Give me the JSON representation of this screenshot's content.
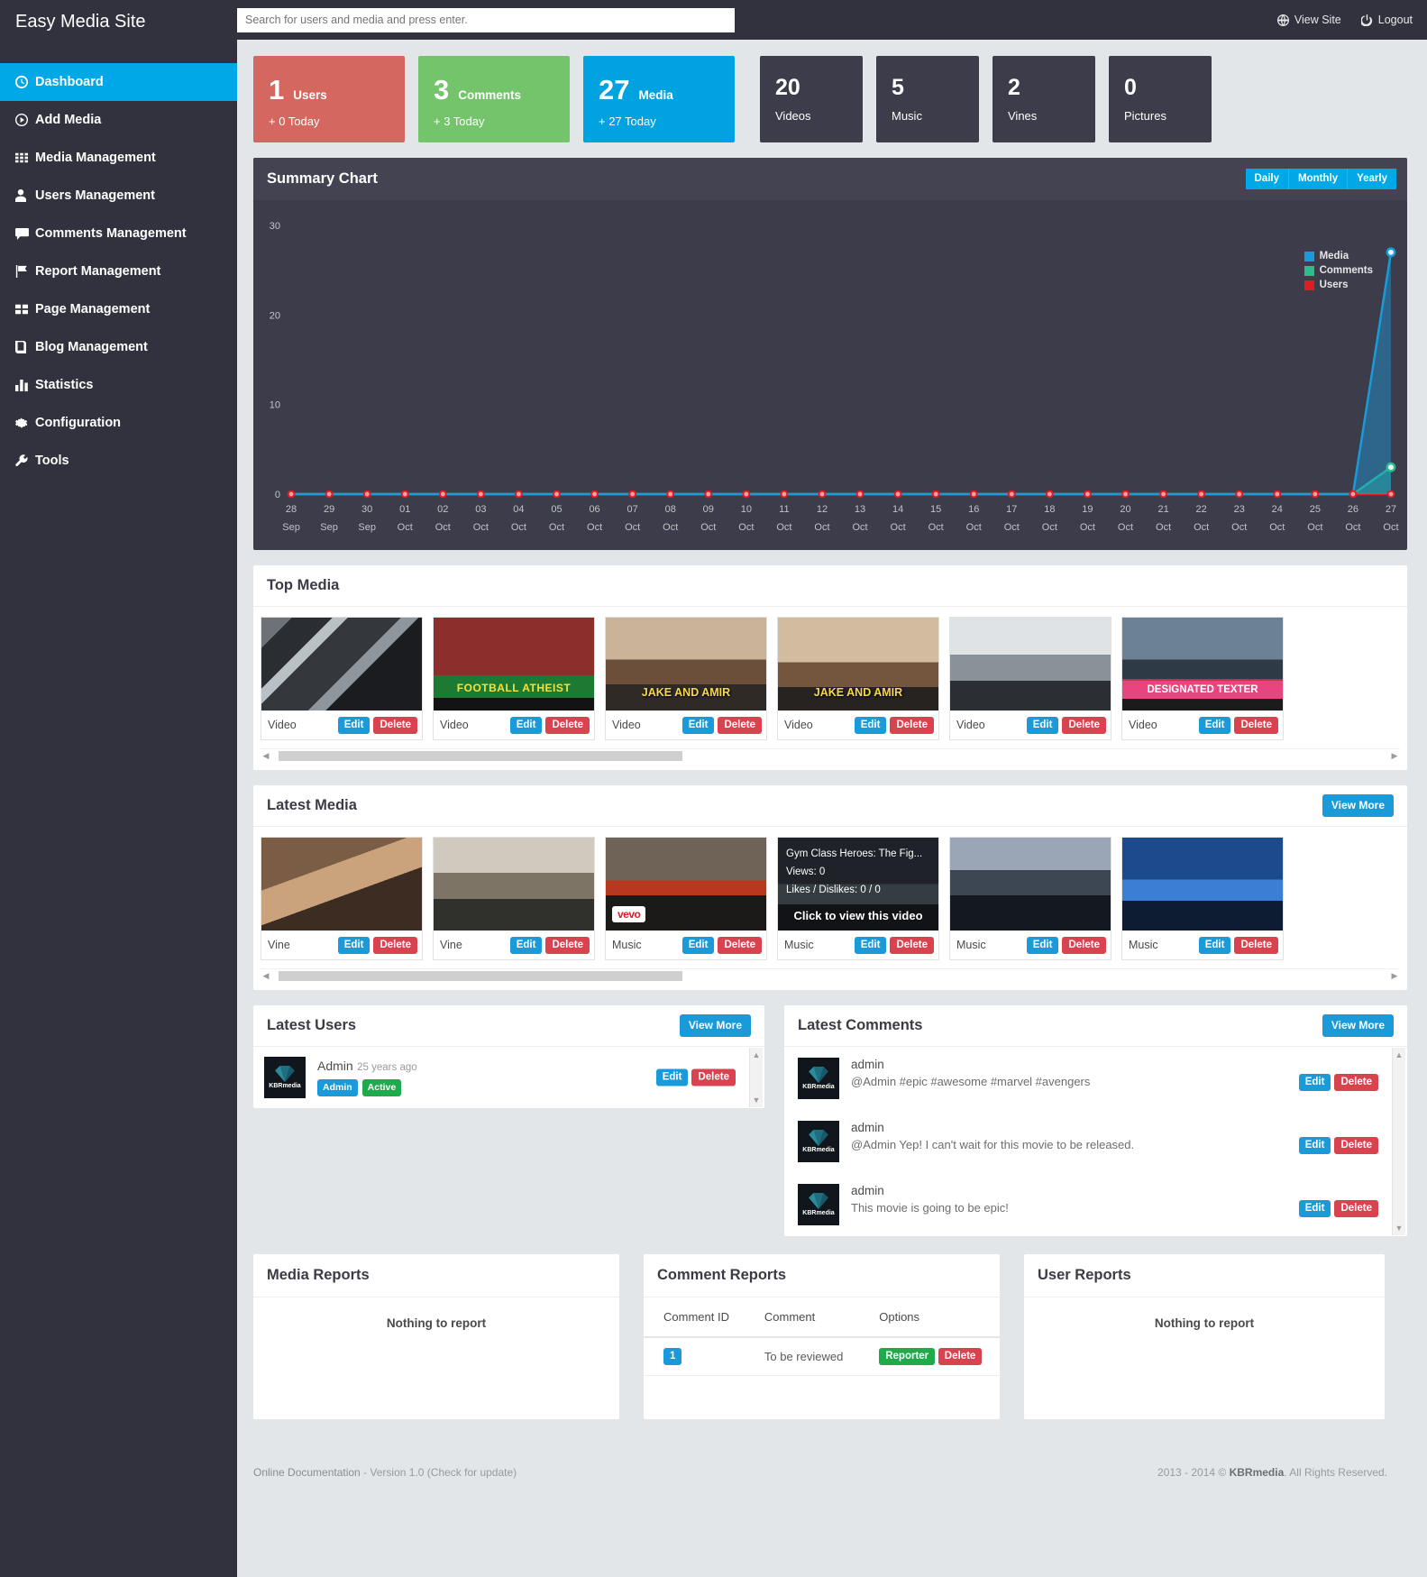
{
  "brand": "Easy Media Site",
  "search": {
    "placeholder": "Search for users and media and press enter."
  },
  "topbar": {
    "view_site": "View Site",
    "logout": "Logout"
  },
  "sidebar": {
    "items": [
      {
        "label": "Dashboard",
        "icon": "dashboard-icon",
        "active": true
      },
      {
        "label": "Add Media",
        "icon": "add-media-icon",
        "active": false
      },
      {
        "label": "Media Management",
        "icon": "grid-icon",
        "active": false
      },
      {
        "label": "Users Management",
        "icon": "user-icon",
        "active": false
      },
      {
        "label": "Comments Management",
        "icon": "comment-icon",
        "active": false
      },
      {
        "label": "Report Management",
        "icon": "flag-icon",
        "active": false
      },
      {
        "label": "Page Management",
        "icon": "pages-icon",
        "active": false
      },
      {
        "label": "Blog Management",
        "icon": "book-icon",
        "active": false
      },
      {
        "label": "Statistics",
        "icon": "bar-chart-icon",
        "active": false
      },
      {
        "label": "Configuration",
        "icon": "gear-icon",
        "active": false
      },
      {
        "label": "Tools",
        "icon": "wrench-icon",
        "active": false
      }
    ]
  },
  "stats": {
    "primary": [
      {
        "value": "1",
        "label": "Users",
        "sub": "+ 0 Today",
        "color": "#d4675f"
      },
      {
        "value": "3",
        "label": "Comments",
        "sub": "+ 3 Today",
        "color": "#73c46b"
      },
      {
        "value": "27",
        "label": "Media",
        "sub": "+ 27 Today",
        "color": "#00a3e0"
      }
    ],
    "secondary": [
      {
        "value": "20",
        "label": "Videos"
      },
      {
        "value": "5",
        "label": "Music"
      },
      {
        "value": "2",
        "label": "Vines"
      },
      {
        "value": "0",
        "label": "Pictures"
      }
    ]
  },
  "chart_panel": {
    "title": "Summary Chart",
    "range_buttons": [
      "Daily",
      "Monthly",
      "Yearly"
    ]
  },
  "chart_data": {
    "type": "line",
    "title": "Summary Chart",
    "xlabel": "",
    "ylabel": "",
    "ylim": [
      0,
      30
    ],
    "yticks": [
      0,
      10,
      20,
      30
    ],
    "grid": false,
    "legend_position": "top-right",
    "categories": [
      "28 Sep",
      "29 Sep",
      "30 Sep",
      "01 Oct",
      "02 Oct",
      "03 Oct",
      "04 Oct",
      "05 Oct",
      "06 Oct",
      "07 Oct",
      "08 Oct",
      "09 Oct",
      "10 Oct",
      "11 Oct",
      "12 Oct",
      "13 Oct",
      "14 Oct",
      "15 Oct",
      "16 Oct",
      "17 Oct",
      "18 Oct",
      "19 Oct",
      "20 Oct",
      "21 Oct",
      "22 Oct",
      "23 Oct",
      "24 Oct",
      "25 Oct",
      "26 Oct",
      "27 Oct"
    ],
    "series": [
      {
        "name": "Media",
        "color": "#1a9ad9",
        "values": [
          0,
          0,
          0,
          0,
          0,
          0,
          0,
          0,
          0,
          0,
          0,
          0,
          0,
          0,
          0,
          0,
          0,
          0,
          0,
          0,
          0,
          0,
          0,
          0,
          0,
          0,
          0,
          0,
          0,
          27
        ]
      },
      {
        "name": "Comments",
        "color": "#2bbd8c",
        "values": [
          0,
          0,
          0,
          0,
          0,
          0,
          0,
          0,
          0,
          0,
          0,
          0,
          0,
          0,
          0,
          0,
          0,
          0,
          0,
          0,
          0,
          0,
          0,
          0,
          0,
          0,
          0,
          0,
          0,
          3
        ]
      },
      {
        "name": "Users",
        "color": "#e01b24",
        "values": [
          0,
          0,
          0,
          0,
          0,
          0,
          0,
          0,
          0,
          0,
          0,
          0,
          0,
          0,
          0,
          0,
          0,
          0,
          0,
          0,
          0,
          0,
          0,
          0,
          0,
          0,
          0,
          0,
          0,
          0
        ]
      }
    ]
  },
  "top_media": {
    "title": "Top Media",
    "items": [
      {
        "label": "Video",
        "thumb": "t1",
        "caption": ""
      },
      {
        "label": "Video",
        "thumb": "t2",
        "caption": "FOOTBALL ATHEIST"
      },
      {
        "label": "Video",
        "thumb": "t3",
        "caption": "JAKE AND AMIR"
      },
      {
        "label": "Video",
        "thumb": "t4",
        "caption": "JAKE AND AMIR"
      },
      {
        "label": "Video",
        "thumb": "t5",
        "caption": ""
      },
      {
        "label": "Video",
        "thumb": "t6",
        "caption": "DESIGNATED TEXTER"
      }
    ],
    "edit_label": "Edit",
    "delete_label": "Delete"
  },
  "latest_media": {
    "title": "Latest Media",
    "view_more": "View More",
    "items": [
      {
        "label": "Vine",
        "thumb": "t7",
        "caption": ""
      },
      {
        "label": "Vine",
        "thumb": "t8",
        "caption": ""
      },
      {
        "label": "Music",
        "thumb": "t9",
        "caption": "vevo"
      },
      {
        "label": "Music",
        "thumb": "t10",
        "caption": "",
        "overlay": {
          "title": "Gym Class Heroes: The Fig...",
          "views": "Views: 0",
          "likes": "Likes / Dislikes: 0 / 0",
          "cta": "Click to view this video"
        }
      },
      {
        "label": "Music",
        "thumb": "t11",
        "caption": ""
      },
      {
        "label": "Music",
        "thumb": "t12",
        "caption": ""
      }
    ],
    "edit_label": "Edit",
    "delete_label": "Delete"
  },
  "latest_users": {
    "title": "Latest Users",
    "view_more": "View More",
    "avatar_text": "KBRmedia",
    "rows": [
      {
        "name": "Admin",
        "time": "25 years ago",
        "tags": [
          "Admin",
          "Active"
        ],
        "edit": "Edit",
        "delete": "Delete"
      }
    ]
  },
  "latest_comments": {
    "title": "Latest Comments",
    "view_more": "View More",
    "avatar_text": "KBRmedia",
    "rows": [
      {
        "user": "admin",
        "text": "@Admin #epic #awesome #marvel #avengers",
        "edit": "Edit",
        "delete": "Delete"
      },
      {
        "user": "admin",
        "text": "@Admin Yep! I can't wait for this movie to be released.",
        "edit": "Edit",
        "delete": "Delete"
      },
      {
        "user": "admin",
        "text": "This movie is going to be epic!",
        "edit": "Edit",
        "delete": "Delete"
      }
    ]
  },
  "media_reports": {
    "title": "Media Reports",
    "empty": "Nothing to report"
  },
  "user_reports": {
    "title": "User Reports",
    "empty": "Nothing to report"
  },
  "comment_reports": {
    "title": "Comment Reports",
    "columns": [
      "Comment ID",
      "Comment",
      "Options"
    ],
    "rows": [
      {
        "id": "1",
        "comment": "To be reviewed",
        "reporter": "Reporter",
        "delete": "Delete"
      }
    ]
  },
  "footer": {
    "doc": "Online Documentation",
    "sep": " - ",
    "version": "Version 1.0 (Check for update)",
    "copyright_pre": "2013 - 2014 © ",
    "copyright_brand": "KBRmedia",
    "copyright_post": ". All Rights Reserved."
  }
}
